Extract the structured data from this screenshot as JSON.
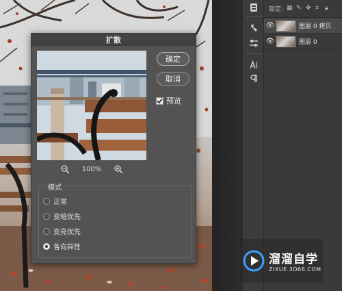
{
  "dialog": {
    "title": "扩散",
    "ok_label": "确定",
    "cancel_label": "取消",
    "preview_label": "预览",
    "preview_checked": true,
    "zoom_level": "100%",
    "zoom_out_icon": "zoom-out-icon",
    "zoom_in_icon": "zoom-in-icon",
    "mode": {
      "legend": "模式",
      "options": [
        {
          "label": "正常",
          "selected": false
        },
        {
          "label": "变暗优先",
          "selected": false
        },
        {
          "label": "变亮优先",
          "selected": false
        },
        {
          "label": "各向异性",
          "selected": true
        }
      ]
    }
  },
  "layers_panel": {
    "lock_label": "锁定:",
    "layers": [
      {
        "name": "图层 0 拷贝",
        "visible": true,
        "selected": true
      },
      {
        "name": "图层 0",
        "visible": true,
        "selected": false
      }
    ]
  },
  "toolstrip": {
    "items": [
      "libraries-icon",
      "brush-settings-icon",
      "adjust-sliders-icon",
      "character-icon",
      "paragraph-icon"
    ]
  },
  "watermark": {
    "title": "溜溜自学",
    "url": "ZIXUE.3D66.COM"
  },
  "colors": {
    "dialog_bg": "#535353",
    "panel_bg": "#3a3a3a",
    "titlebar": "#424242"
  }
}
